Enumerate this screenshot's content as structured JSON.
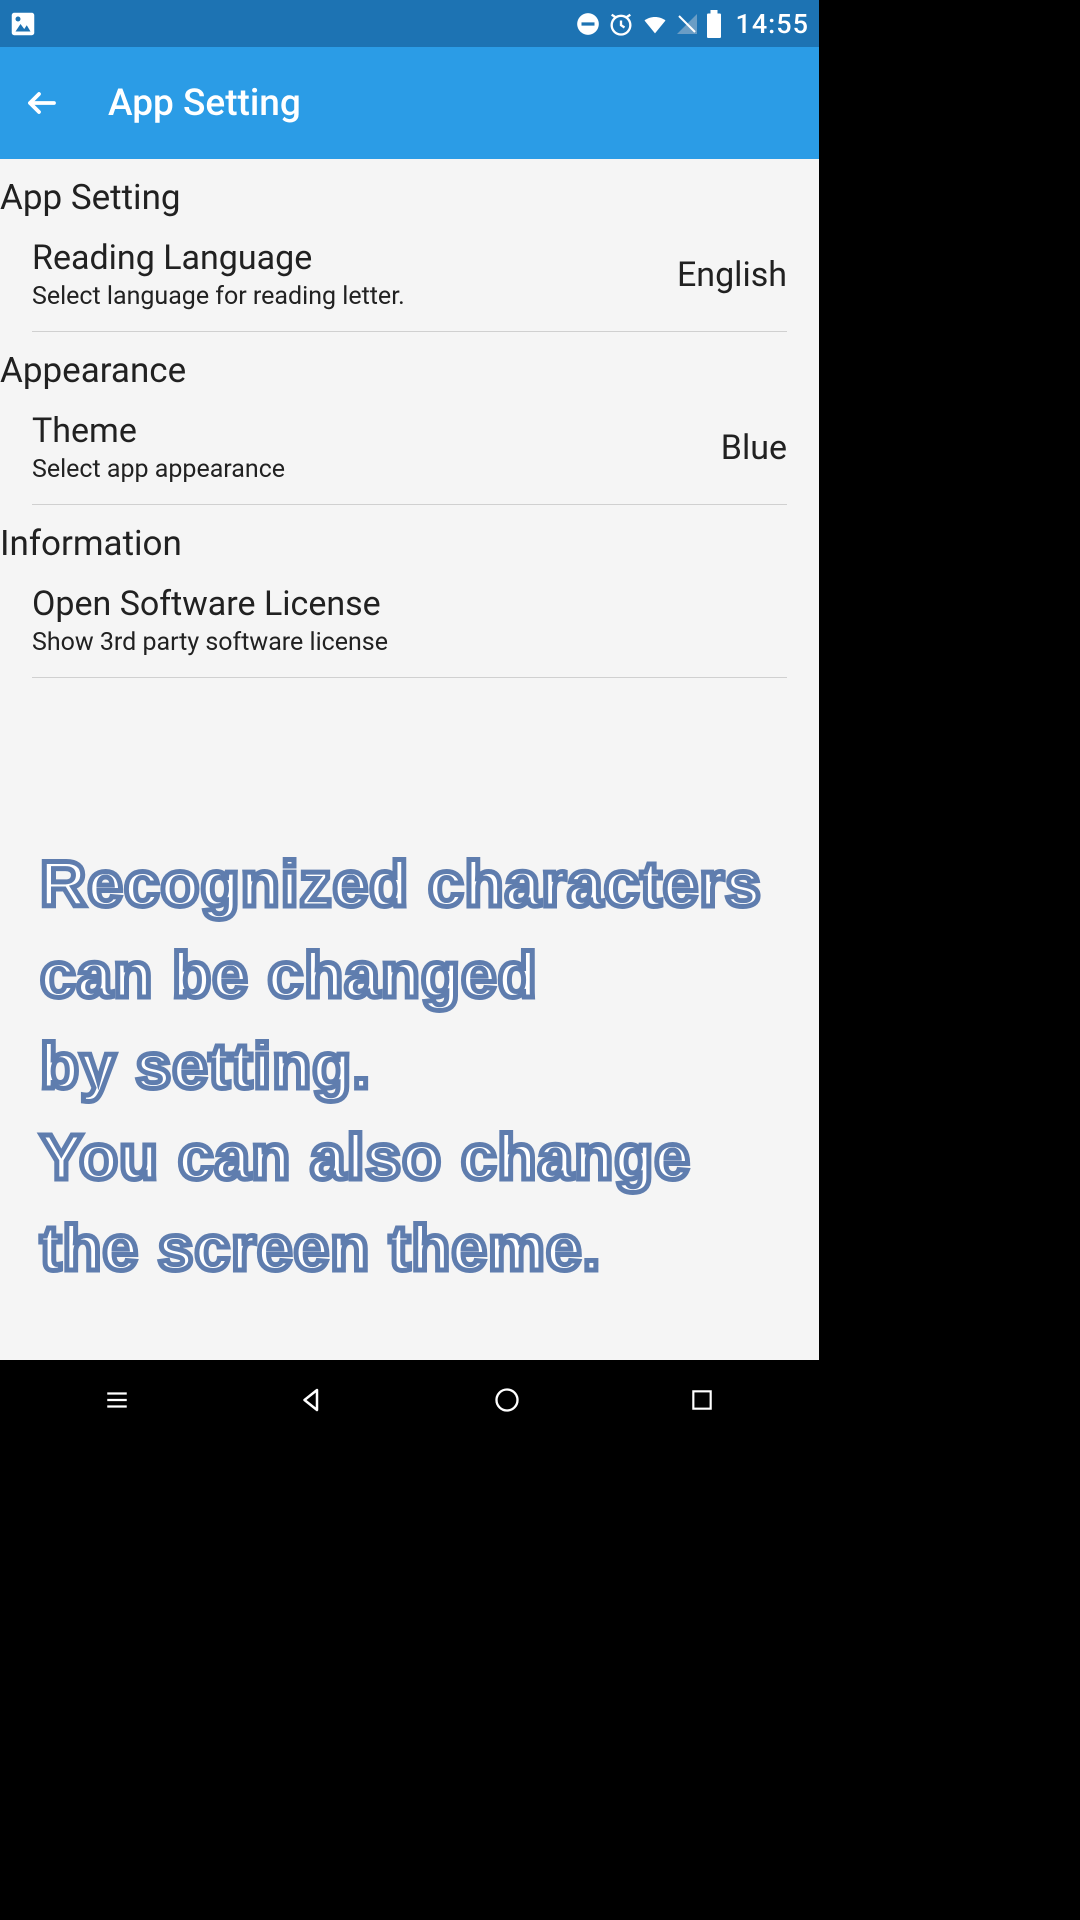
{
  "status_bar": {
    "time": "14:55"
  },
  "app_bar": {
    "title": "App Setting"
  },
  "sections": {
    "app_setting": {
      "header": "App Setting",
      "item": {
        "title": "Reading Language",
        "subtitle": "Select language for reading letter.",
        "value": "English"
      }
    },
    "appearance": {
      "header": "Appearance",
      "item": {
        "title": "Theme",
        "subtitle": "Select app appearance",
        "value": "Blue"
      }
    },
    "information": {
      "header": "Information",
      "item": {
        "title": "Open Software License",
        "subtitle": "Show 3rd party software license"
      }
    }
  },
  "overlay": {
    "line1": "Recognized characters",
    "line2": "can be changed",
    "line3": "by setting.",
    "line4": "You can also change",
    "line5": "the screen theme."
  }
}
